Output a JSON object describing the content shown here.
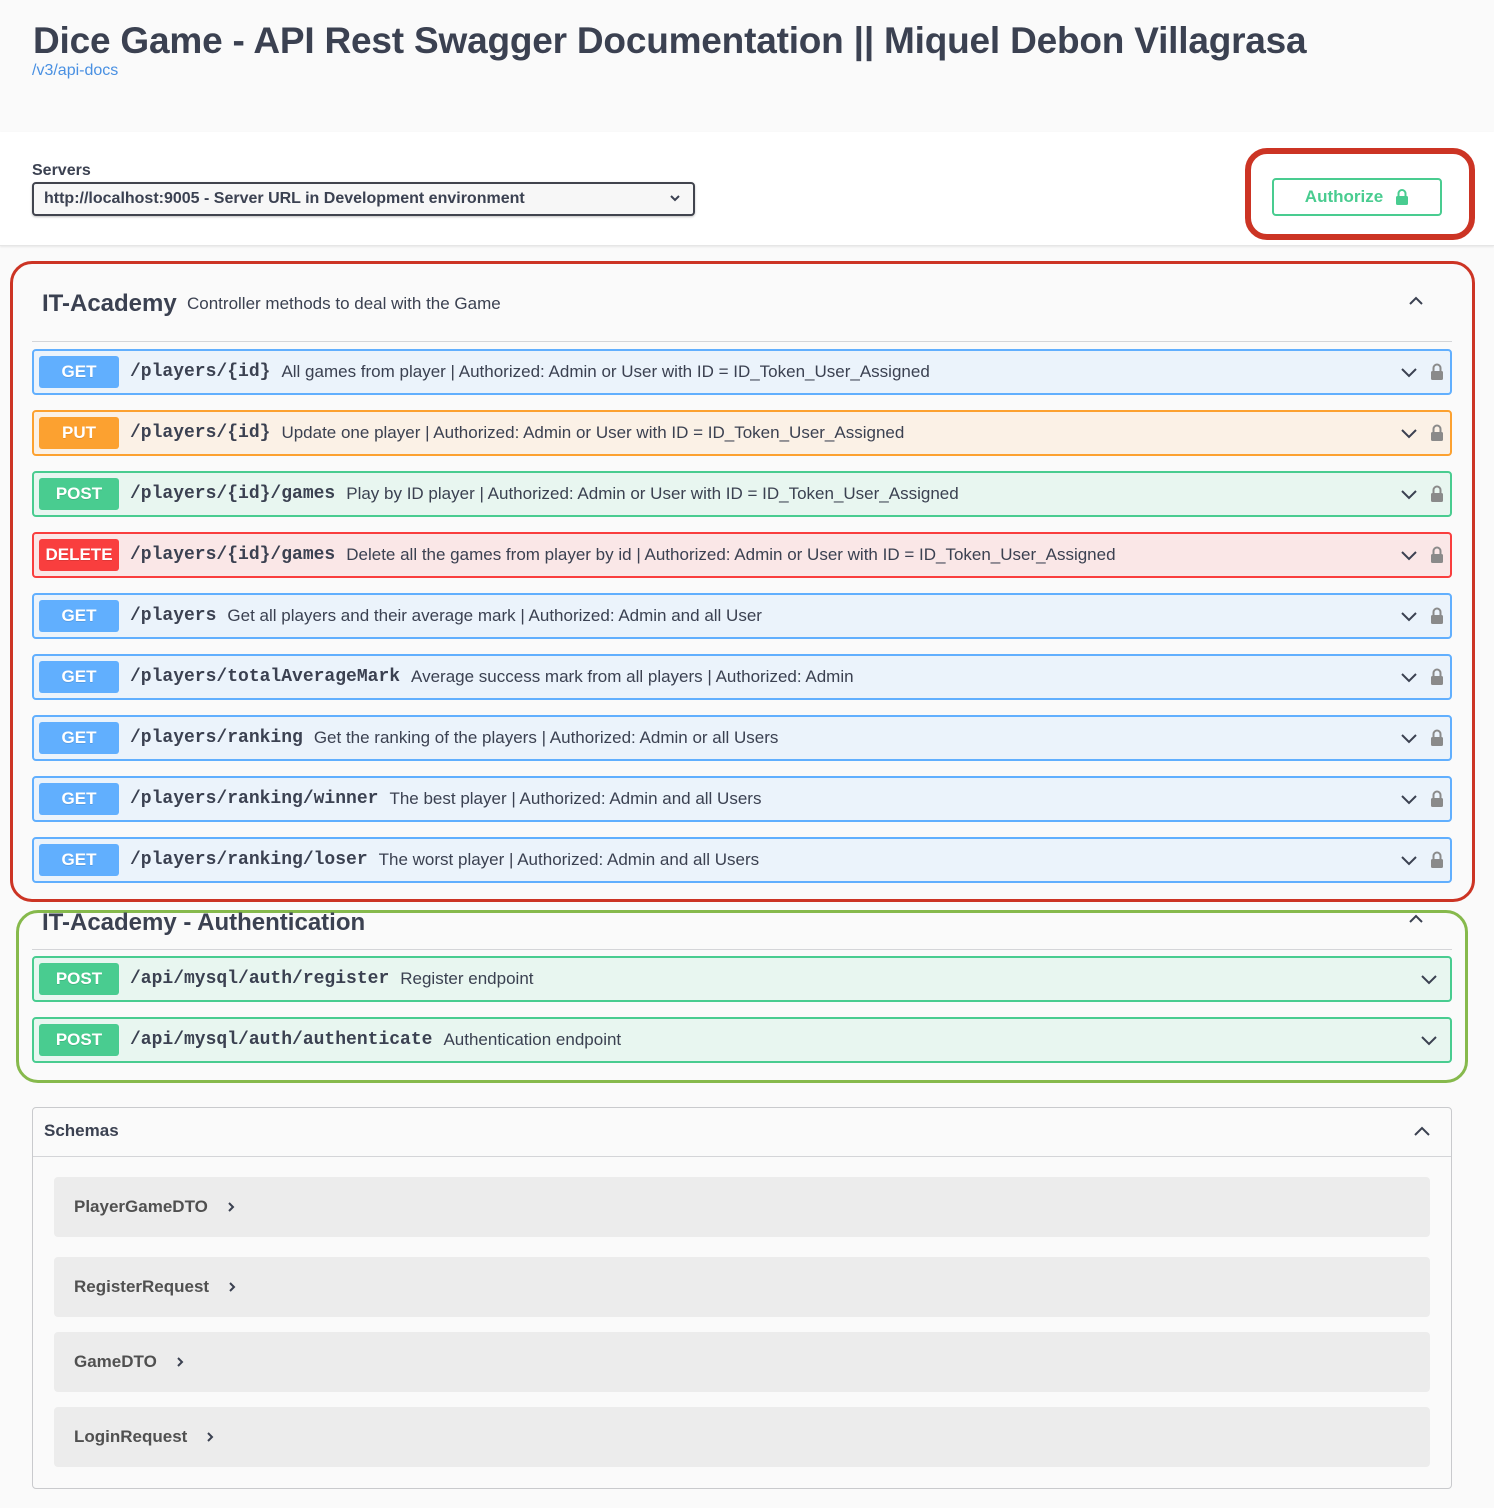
{
  "header": {
    "title": "Dice Game - API Rest Swagger Documentation || Miquel Debon Villagrasa",
    "api_docs_link": "/v3/api-docs"
  },
  "servers": {
    "label": "Servers",
    "selected": "http://localhost:9005 - Server URL in Development environment"
  },
  "authorize": {
    "label": "Authorize"
  },
  "tags": [
    {
      "name": "IT-Academy",
      "description": "Controller methods to deal with the Game",
      "operations": [
        {
          "method": "GET",
          "path": "/players/{id}",
          "summary": "All games from player | Authorized: Admin or User with ID = ID_Token_User_Assigned"
        },
        {
          "method": "PUT",
          "path": "/players/{id}",
          "summary": "Update one player | Authorized: Admin or User with ID = ID_Token_User_Assigned"
        },
        {
          "method": "POST",
          "path": "/players/{id}/games",
          "summary": "Play by ID player | Authorized: Admin or User with ID = ID_Token_User_Assigned"
        },
        {
          "method": "DELETE",
          "path": "/players/{id}/games",
          "summary": "Delete all the games from player by id | Authorized: Admin or User with ID = ID_Token_User_Assigned"
        },
        {
          "method": "GET",
          "path": "/players",
          "summary": "Get all players and their average mark | Authorized: Admin and all User"
        },
        {
          "method": "GET",
          "path": "/players/totalAverageMark",
          "summary": "Average success mark from all players | Authorized: Admin"
        },
        {
          "method": "GET",
          "path": "/players/ranking",
          "summary": "Get the ranking of the players | Authorized: Admin or all Users"
        },
        {
          "method": "GET",
          "path": "/players/ranking/winner",
          "summary": "The best player | Authorized: Admin and all Users"
        },
        {
          "method": "GET",
          "path": "/players/ranking/loser",
          "summary": "The worst player | Authorized: Admin and all Users"
        }
      ]
    },
    {
      "name": "IT-Academy - Authentication",
      "description": "",
      "operations": [
        {
          "method": "POST",
          "path": "/api/mysql/auth/register",
          "summary": "Register endpoint"
        },
        {
          "method": "POST",
          "path": "/api/mysql/auth/authenticate",
          "summary": "Authentication endpoint"
        }
      ]
    }
  ],
  "schemas": {
    "title": "Schemas",
    "models": [
      "PlayerGameDTO",
      "RegisterRequest",
      "GameDTO",
      "LoginRequest"
    ]
  },
  "colors": {
    "get": "#61affe",
    "put": "#fca130",
    "post": "#49cc90",
    "delete": "#f93e3e",
    "highlight_red": "#cc3424",
    "highlight_green": "#86b94c",
    "link": "#4990e2"
  }
}
